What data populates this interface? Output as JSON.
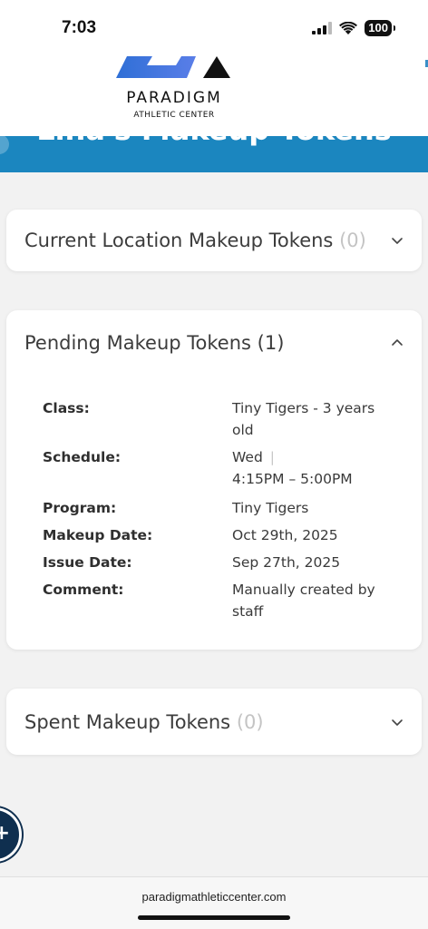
{
  "status_bar": {
    "time": "7:03",
    "battery": "100"
  },
  "header": {
    "brand_name": "PARADIGM",
    "brand_sub": "ATHLETIC CENTER",
    "page_title": "Lina's Makeup Tokens",
    "colors": {
      "banner": "#1b86bf",
      "logo_blue": "#3b6fd8",
      "text": "#3a3a3a"
    }
  },
  "sections": {
    "current": {
      "title": "Current Location Makeup Tokens",
      "count": "(0)",
      "expanded": false
    },
    "pending": {
      "title": "Pending Makeup Tokens",
      "count": "(1)",
      "expanded": true,
      "details": {
        "class_label": "Class:",
        "class_value": "Tiny Tigers - 3 years old",
        "schedule_label": "Schedule:",
        "schedule_day": "Wed",
        "schedule_sep": "|",
        "schedule_time": "4:15PM – 5:00PM",
        "program_label": "Program:",
        "program_value": "Tiny Tigers",
        "makeup_date_label": "Makeup Date:",
        "makeup_date_value": "Oct 29th, 2025",
        "issue_date_label": "Issue Date:",
        "issue_date_value": "Sep 27th, 2025",
        "comment_label": "Comment:",
        "comment_value": "Manually created by staff"
      }
    },
    "spent": {
      "title": "Spent Makeup Tokens",
      "count": "(0)",
      "expanded": false
    }
  },
  "browser": {
    "url": "paradigmathleticcenter.com"
  }
}
